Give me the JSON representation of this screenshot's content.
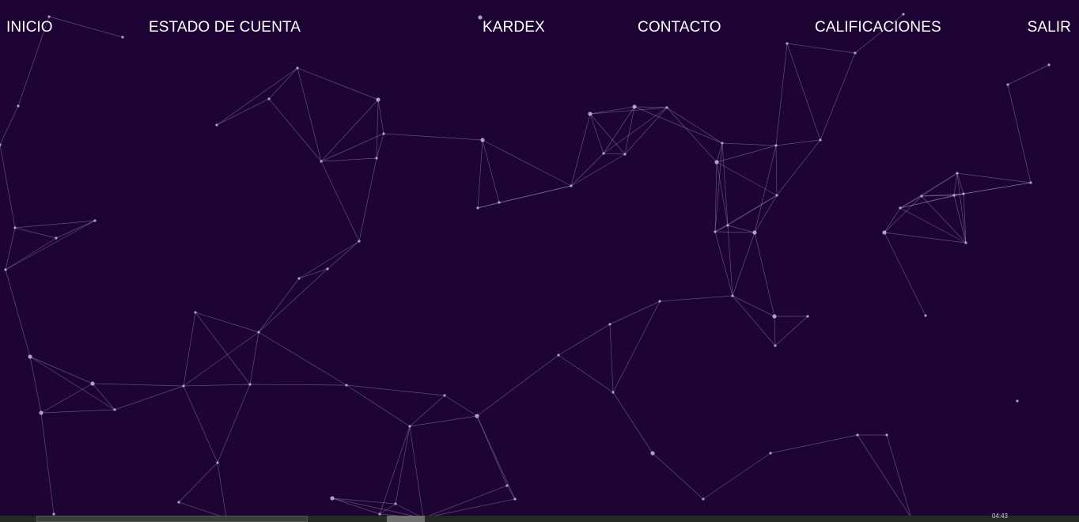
{
  "nav": {
    "inicio": "INICIO",
    "estado_de_cuenta": "ESTADO DE CUENTA",
    "kardex": "KARDEX",
    "contacto": "CONTACTO",
    "calificaciones": "CALIFICACIONES",
    "salir": "SALIR"
  },
  "taskbar": {
    "clock": "04:43"
  },
  "colors": {
    "background": "#1e0435",
    "nav_text": "#ffffff",
    "particle": "#c8b6dc",
    "taskbar": "#252a25"
  },
  "icons": [
    "particle-network-background"
  ]
}
